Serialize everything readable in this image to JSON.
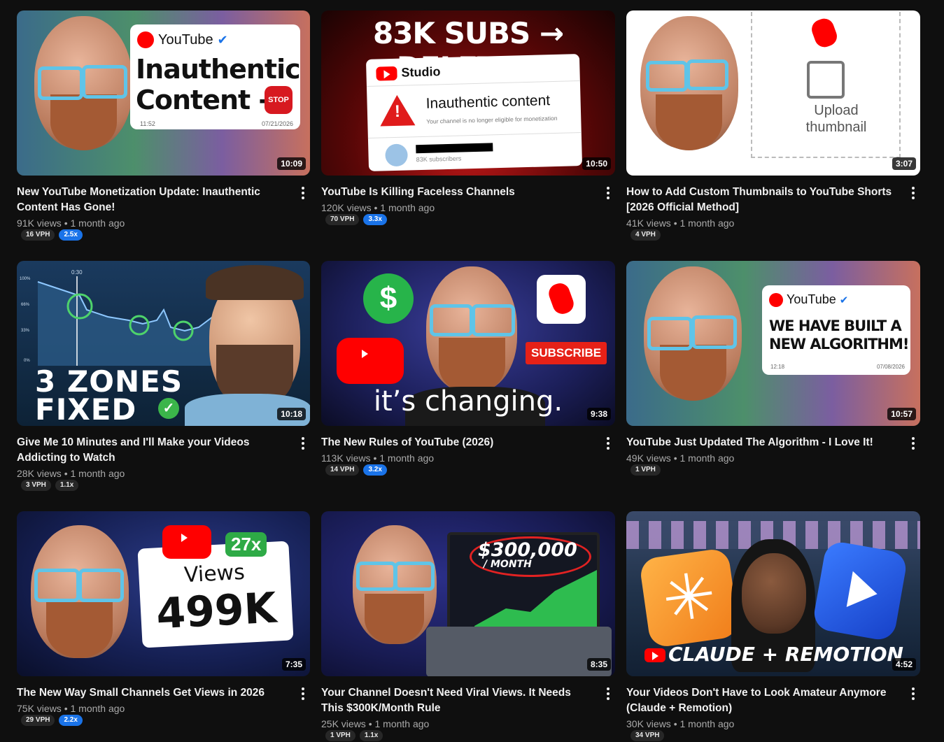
{
  "videos": [
    {
      "title": "New YouTube Monetization Update: Inauthentic Content Has Gone!",
      "views": "91K views",
      "age": "1 month ago",
      "vph": "16 VPH",
      "multiplier": "2.5x",
      "hot": true,
      "duration": "10:09",
      "thumb": {
        "brand": "YouTube",
        "line1": "Inauthentic",
        "line2": "Content -",
        "stop": "STOP",
        "time": "11:52",
        "date": "07/21/2026"
      }
    },
    {
      "title": "YouTube Is Killing Faceless Channels",
      "views": "120K views",
      "age": "1 month ago",
      "vph": "70 VPH",
      "multiplier": "3.3x",
      "hot": true,
      "duration": "10:50",
      "thumb": {
        "headline": "83K SUBS → DELETED",
        "studio": "Studio",
        "warning": "Inauthentic content",
        "detail": "Your channel is no longer eligible for monetization",
        "subs": "83K subscribers"
      }
    },
    {
      "title": "How to Add Custom Thumbnails to YouTube Shorts [2026 Official Method]",
      "views": "41K views",
      "age": "1 month ago",
      "vph": "4 VPH",
      "multiplier": "",
      "hot": false,
      "duration": "3:07",
      "thumb": {
        "upload": "Upload",
        "thumbnail": "thumbnail"
      }
    },
    {
      "title": "Give Me 10 Minutes and I'll Make your Videos Addicting to Watch",
      "views": "28K views",
      "age": "1 month ago",
      "vph": "3 VPH",
      "multiplier": "1.1x",
      "hot": false,
      "duration": "10:18",
      "thumb": {
        "line1": "3 ZONES",
        "line2": "FIXED",
        "t": "0:30",
        "y100": "100%",
        "y66": "66%",
        "y33": "33%",
        "y0": "0%"
      }
    },
    {
      "title": "The New Rules of YouTube (2026)",
      "views": "113K views",
      "age": "1 month ago",
      "vph": "14 VPH",
      "multiplier": "3.2x",
      "hot": true,
      "duration": "9:38",
      "thumb": {
        "subscribe": "SUBSCRIBE",
        "caption": "it’s changing."
      }
    },
    {
      "title": "YouTube Just Updated The Algorithm - I Love It!",
      "views": "49K views",
      "age": "1 month ago",
      "vph": "1 VPH",
      "multiplier": "",
      "hot": false,
      "duration": "10:57",
      "thumb": {
        "brand": "YouTube",
        "line1": "WE HAVE BUILT A",
        "line2": "NEW ALGORITHM!",
        "time": "12:18",
        "date": "07/08/2026"
      }
    },
    {
      "title": "The New Way Small Channels Get Views in 2026",
      "views": "75K views",
      "age": "1 month ago",
      "vph": "29 VPH",
      "multiplier": "2.2x",
      "hot": true,
      "duration": "7:35",
      "thumb": {
        "mult": "27x",
        "label": "Views",
        "count": "499K"
      }
    },
    {
      "title": "Your Channel Doesn't Need Viral Views. It Needs This $300K/Month Rule",
      "views": "25K views",
      "age": "1 month ago",
      "vph": "1 VPH",
      "multiplier": "1.1x",
      "hot": false,
      "duration": "8:35",
      "thumb": {
        "amount": "$300,000",
        "per": "/ MONTH"
      }
    },
    {
      "title": "Your Videos Don't Have to Look Amateur Anymore (Claude + Remotion)",
      "views": "30K views",
      "age": "1 month ago",
      "vph": "34 VPH",
      "multiplier": "",
      "hot": false,
      "duration": "4:52",
      "thumb": {
        "caption": "CLAUDE + REMOTION"
      }
    }
  ],
  "colors": {
    "background": "#0f0f0f",
    "accent_badge": "#1a73e8",
    "youtube_red": "#ff0000",
    "glasses": "#5fc4e8"
  }
}
